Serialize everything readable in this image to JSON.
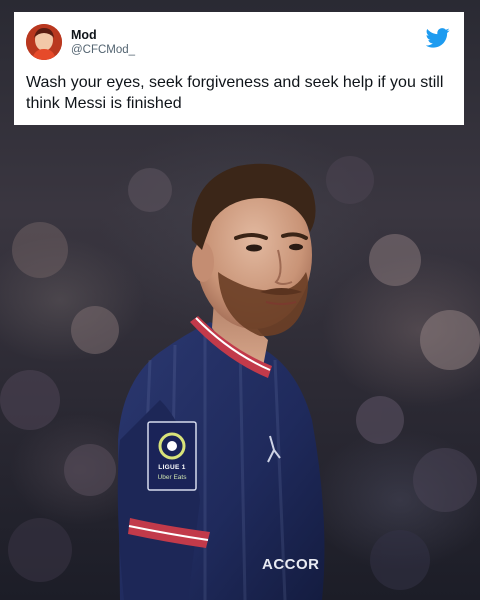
{
  "tweet": {
    "display_name": "Mod",
    "handle": "@CFCMod_",
    "text": "Wash your eyes, seek forgiveness and seek help if you still think Messi is finished",
    "avatar_icon": "user-avatar",
    "platform_icon": "twitter-bird-icon",
    "brand_color": "#1D9BF0"
  },
  "photo": {
    "badge_line1": "LIGUE 1",
    "badge_line2": "Uber Eats",
    "shirt_sponsor": "ACCOR",
    "shirt_color": "#1f2a5c",
    "trim_color": "#c23a4a"
  }
}
